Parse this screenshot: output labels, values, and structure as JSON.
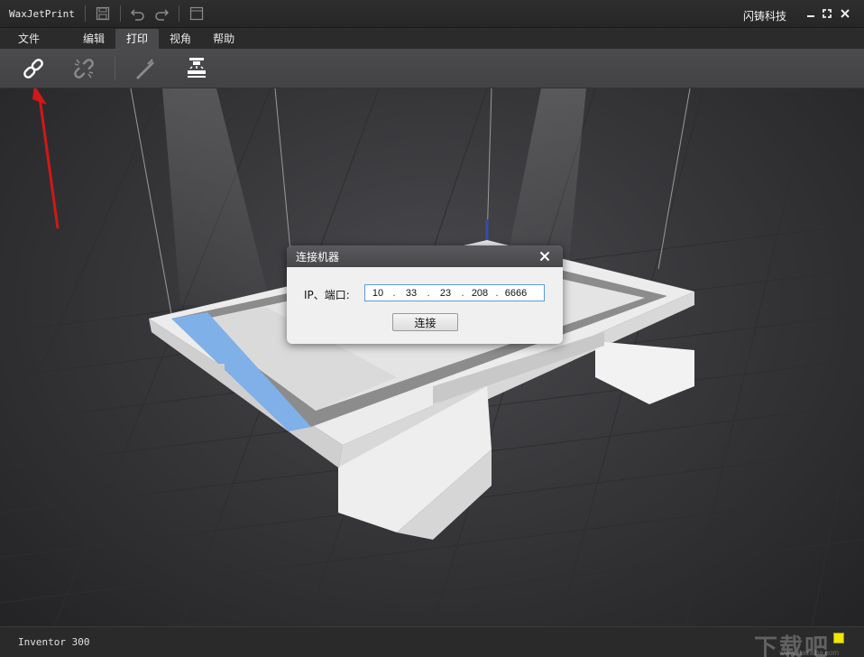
{
  "window": {
    "title": "WaxJetPrint",
    "brand": "闪铸科技"
  },
  "menu": {
    "items": [
      "文件",
      "编辑",
      "打印",
      "视角",
      "帮助"
    ],
    "active": "打印"
  },
  "toolbar": {
    "buttons": [
      "connect-machine",
      "disconnect-machine",
      "print",
      "platform"
    ]
  },
  "dialog": {
    "title": "连接机器",
    "ip_label": "IP、端口:",
    "ip_parts": [
      "10",
      "33",
      "23",
      "208"
    ],
    "port": "6666",
    "separator": ".",
    "connect_label": "连接"
  },
  "status": {
    "printer": "Inventor 300",
    "watermark": "下载吧",
    "watermark_url": "www.xiazaiba.com"
  },
  "colors": {
    "accent_blue": "#7fb0e8",
    "arrow_red": "#d01818",
    "indicator": "#f2e600"
  }
}
